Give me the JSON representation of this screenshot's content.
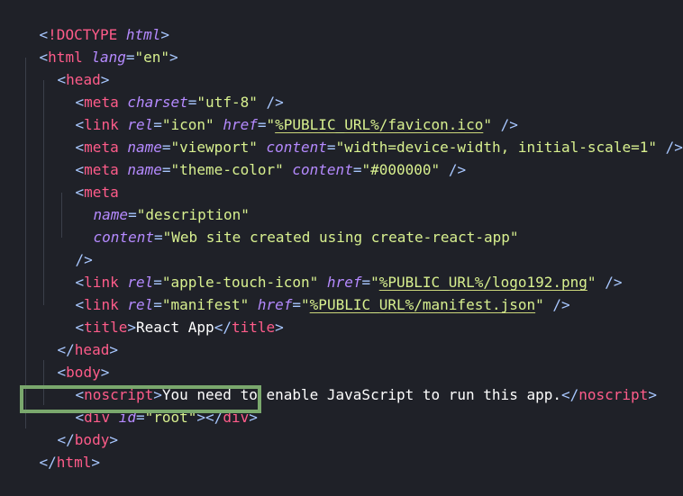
{
  "editor": {
    "lines": [
      {
        "tag_open": "<",
        "keyword": "!DOCTYPE",
        "space": " ",
        "attr": "html",
        "tag_close": ">"
      },
      {
        "text": "<html lang=\"en\">"
      },
      {
        "text": "<head>"
      },
      {
        "text": "<meta charset=\"utf-8\" />"
      },
      {
        "text": "<link rel=\"icon\" href=\"%PUBLIC_URL%/favicon.ico\" />"
      },
      {
        "text": "<meta name=\"viewport\" content=\"width=device-width, initial-scale=1\" />"
      },
      {
        "text": "<meta name=\"theme-color\" content=\"#000000\" />"
      },
      {
        "text": "<meta"
      },
      {
        "text": "name=\"description\""
      },
      {
        "text": "content=\"Web site created using create-react-app\""
      },
      {
        "text": "/>"
      },
      {
        "text": "<link rel=\"apple-touch-icon\" href=\"%PUBLIC_URL%/logo192.png\" />"
      },
      {
        "text": "<link rel=\"manifest\" href=\"%PUBLIC_URL%/manifest.json\" />"
      },
      {
        "text": "<title>React App</title>"
      },
      {
        "text": "</head>"
      },
      {
        "text": "<body>"
      },
      {
        "text": "<noscript>You need to enable JavaScript to run this app.</noscript>"
      },
      {
        "text": "<div id=\"root\"></div>"
      },
      {
        "text": "</body>"
      },
      {
        "text": "</html>"
      }
    ],
    "tokens": {
      "doctype_kw": "!DOCTYPE",
      "html": "html",
      "lang": "lang",
      "en": "\"en\"",
      "head": "head",
      "meta": "meta",
      "charset": "charset",
      "utf8": "\"utf-8\"",
      "link": "link",
      "rel": "rel",
      "icon": "\"icon\"",
      "href": "href",
      "favicon_url": "%PUBLIC_URL%/favicon.ico",
      "name": "name",
      "viewport": "\"viewport\"",
      "content": "content",
      "viewport_content": "\"width=device-width, initial-scale=1\"",
      "theme_color": "\"theme-color\"",
      "color_value": "\"#000000\"",
      "description": "\"description\"",
      "description_content": "\"Web site created using create-react-app\"",
      "apple_touch_icon": "\"apple-touch-icon\"",
      "logo_url": "%PUBLIC_URL%/logo192.png",
      "manifest": "\"manifest\"",
      "manifest_url": "%PUBLIC_URL%/manifest.json",
      "title": "title",
      "title_text": "React App",
      "body": "body",
      "noscript": "noscript",
      "noscript_text": "You need to enable JavaScript to run this app.",
      "div": "div",
      "id": "id",
      "root": "\"root\""
    }
  },
  "highlight": {
    "color": "#7aa86d"
  },
  "colors": {
    "background": "#1f2128",
    "tag": "#ff5c8a",
    "punctuation": "#a8c7ff",
    "attribute": "#b58aff",
    "string": "#d8f08f",
    "text": "#ffffff"
  }
}
